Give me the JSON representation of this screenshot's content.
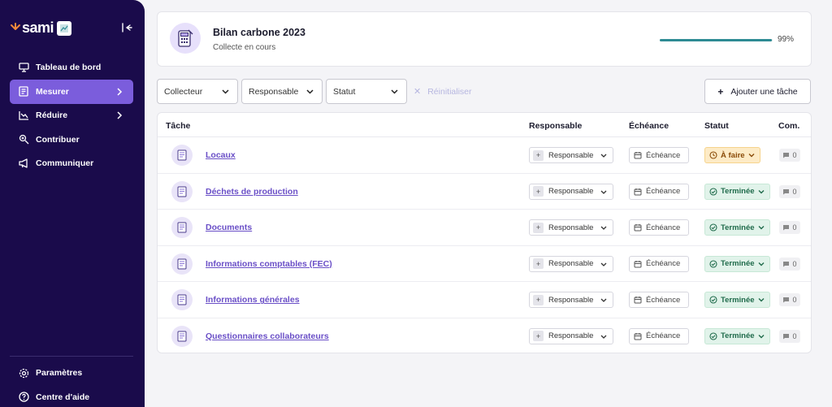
{
  "brand": {
    "name": "sami"
  },
  "sidebar": {
    "items": [
      {
        "label": "Tableau de bord",
        "icon": "dashboard-icon"
      },
      {
        "label": "Mesurer",
        "icon": "measure-icon",
        "active": true
      },
      {
        "label": "Réduire",
        "icon": "reduce-icon"
      },
      {
        "label": "Contribuer",
        "icon": "contribute-icon"
      },
      {
        "label": "Communiquer",
        "icon": "megaphone-icon"
      }
    ],
    "bottom": [
      {
        "label": "Paramètres",
        "icon": "gear-icon"
      },
      {
        "label": "Centre d'aide",
        "icon": "help-icon"
      }
    ]
  },
  "project": {
    "title": "Bilan carbone 2023",
    "subtitle": "Collecte en cours",
    "progress_label": "99%",
    "progress_value": 0.99
  },
  "filters": {
    "collecteur": "Collecteur",
    "responsable": "Responsable",
    "statut": "Statut",
    "reset": "Réinitialiser",
    "add_task": "Ajouter une tâche"
  },
  "table": {
    "headers": {
      "task": "Tâche",
      "owner": "Responsable",
      "due": "Échéance",
      "status": "Statut",
      "comments": "Com."
    },
    "rows": [
      {
        "name": "Locaux",
        "owner": "Responsable",
        "due": "Échéance",
        "status": "À faire",
        "status_type": "todo",
        "comments": "0"
      },
      {
        "name": "Déchets de production",
        "owner": "Responsable",
        "due": "Échéance",
        "status": "Terminée",
        "status_type": "done",
        "comments": "0"
      },
      {
        "name": "Documents",
        "owner": "Responsable",
        "due": "Échéance",
        "status": "Terminée",
        "status_type": "done",
        "comments": "0"
      },
      {
        "name": "Informations comptables (FEC)",
        "owner": "Responsable",
        "due": "Échéance",
        "status": "Terminée",
        "status_type": "done",
        "comments": "0"
      },
      {
        "name": "Informations générales",
        "owner": "Responsable",
        "due": "Échéance",
        "status": "Terminée",
        "status_type": "done",
        "comments": "0"
      },
      {
        "name": "Questionnaires collaborateurs",
        "owner": "Responsable",
        "due": "Échéance",
        "status": "Terminée",
        "status_type": "done",
        "comments": "0"
      }
    ]
  },
  "colors": {
    "sidebar": "#1a0b4b",
    "accent": "#7b5ddc",
    "progress": "#2e8b94",
    "link": "#6a4fc7"
  }
}
